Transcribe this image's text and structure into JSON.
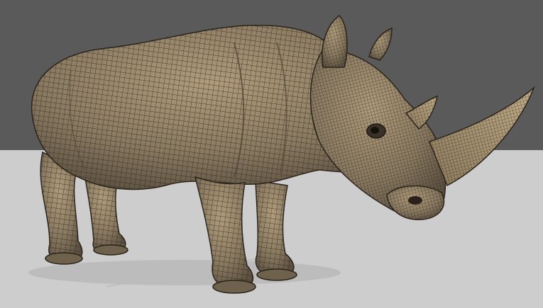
{
  "viewport": {
    "background_color": "#5a5a5a",
    "floor_color": "#cdcdcd",
    "subject": "rhino-wireframe-model",
    "colors": {
      "skin": "#8a7a61",
      "skin_light": "#a99677",
      "skin_dark": "#5d5141",
      "wire": "#2a241c",
      "horn": "#a89472"
    }
  }
}
